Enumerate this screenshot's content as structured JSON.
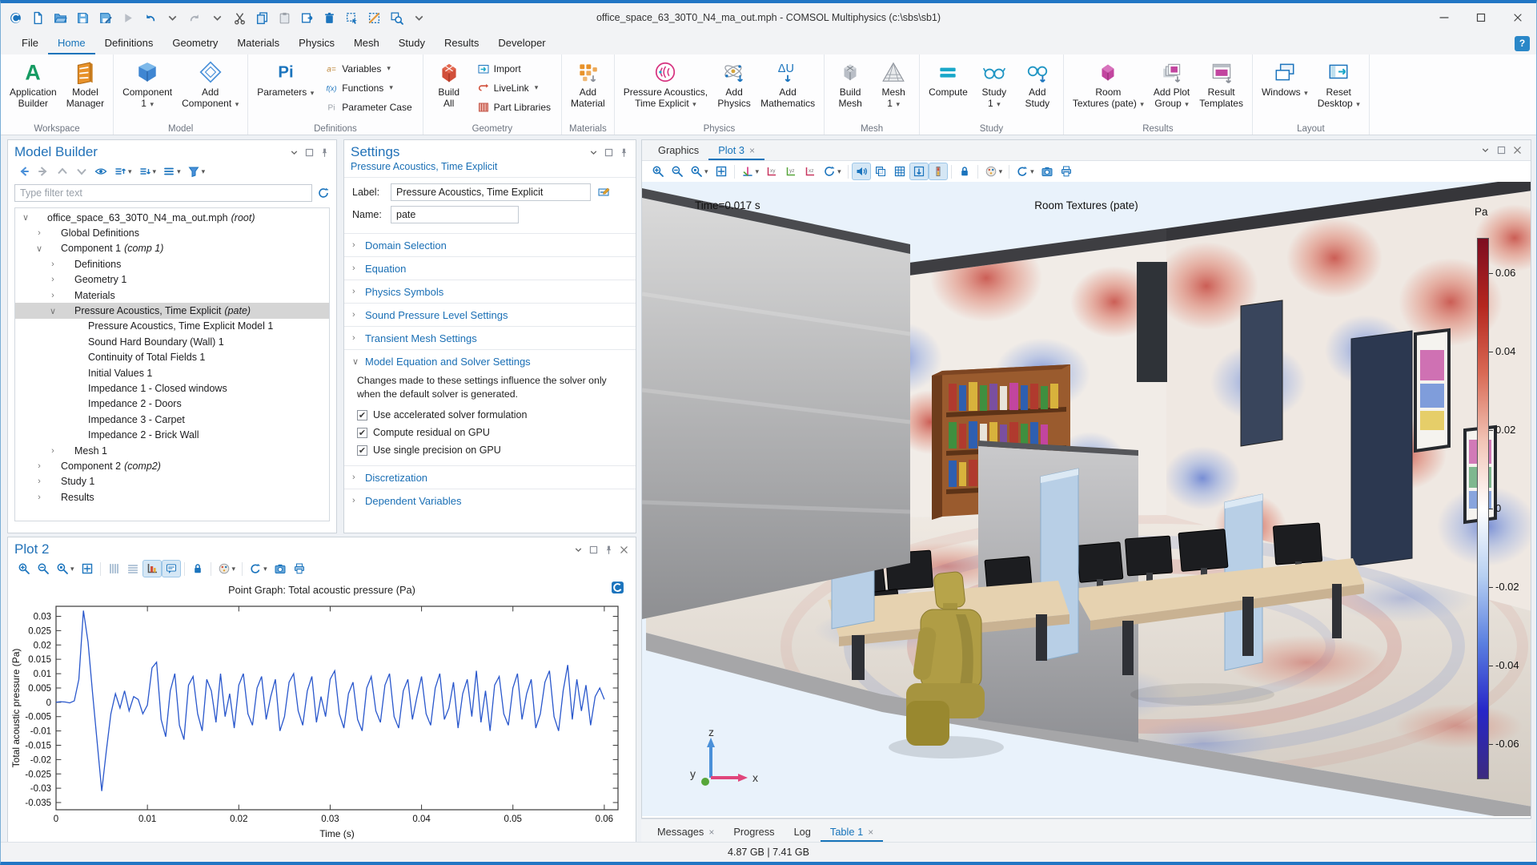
{
  "window": {
    "title": "office_space_63_30T0_N4_ma_out.mph - COMSOL Multiphysics (c:\\sbs\\sb1)"
  },
  "qat": [
    "comsol-logo",
    "new-file",
    "open-file",
    "save",
    "save-as",
    "run",
    "undo",
    "chevdn",
    "redo",
    "chevdn",
    "cut",
    "copy",
    "paste",
    "duplicate",
    "delete",
    "select-box",
    "deselect",
    "zoom-select",
    "chevdn"
  ],
  "menubar": {
    "items": [
      "File",
      "Home",
      "Definitions",
      "Geometry",
      "Materials",
      "Physics",
      "Mesh",
      "Study",
      "Results",
      "Developer"
    ],
    "active": "Home",
    "help": "?"
  },
  "ribbon": {
    "groups": [
      {
        "label": "Workspace",
        "buttons": [
          {
            "type": "large",
            "label": "Application\nBuilder",
            "icon": "app-builder"
          },
          {
            "type": "large",
            "label": "Model\nManager",
            "icon": "model-manager"
          }
        ]
      },
      {
        "label": "Model",
        "buttons": [
          {
            "type": "large",
            "label": "Component\n1",
            "icon": "component",
            "dd": true
          },
          {
            "type": "large",
            "label": "Add\nComponent",
            "icon": "add-component",
            "dd": true
          }
        ]
      },
      {
        "label": "Definitions",
        "buttons": [
          {
            "type": "large",
            "label": "Parameters",
            "icon": "parameters",
            "dd": true
          },
          {
            "type": "stack",
            "items": [
              {
                "label": "Variables",
                "icon": "variables",
                "dd": true
              },
              {
                "label": "Functions",
                "icon": "functions",
                "dd": true
              },
              {
                "label": "Parameter Case",
                "icon": "parameter-case"
              }
            ]
          }
        ]
      },
      {
        "label": "Geometry",
        "buttons": [
          {
            "type": "large",
            "label": "Build\nAll",
            "icon": "build-all"
          },
          {
            "type": "stack",
            "items": [
              {
                "label": "Import",
                "icon": "import"
              },
              {
                "label": "LiveLink",
                "icon": "livelink",
                "dd": true
              },
              {
                "label": "Part Libraries",
                "icon": "part-libraries"
              }
            ]
          }
        ]
      },
      {
        "label": "Materials",
        "buttons": [
          {
            "type": "large",
            "label": "Add\nMaterial",
            "icon": "add-material"
          }
        ]
      },
      {
        "label": "Physics",
        "buttons": [
          {
            "type": "large",
            "label": "Pressure Acoustics,\nTime Explicit",
            "icon": "pate",
            "dd": true
          },
          {
            "type": "large",
            "label": "Add\nPhysics",
            "icon": "add-physics"
          },
          {
            "type": "large",
            "label": "Add\nMathematics",
            "icon": "add-mathematics"
          }
        ]
      },
      {
        "label": "Mesh",
        "buttons": [
          {
            "type": "large",
            "label": "Build\nMesh",
            "icon": "build-mesh"
          },
          {
            "type": "large",
            "label": "Mesh\n1",
            "icon": "mesh",
            "dd": true
          }
        ]
      },
      {
        "label": "Study",
        "buttons": [
          {
            "type": "large",
            "label": "Compute",
            "icon": "compute"
          },
          {
            "type": "large",
            "label": "Study\n1",
            "icon": "study",
            "dd": true
          },
          {
            "type": "large",
            "label": "Add\nStudy",
            "icon": "add-study"
          }
        ]
      },
      {
        "label": "Results",
        "buttons": [
          {
            "type": "large",
            "label": "Room\nTextures (pate)",
            "icon": "room-textures",
            "dd": true
          },
          {
            "type": "large",
            "label": "Add Plot\nGroup",
            "icon": "add-plot-group",
            "dd": true
          },
          {
            "type": "large",
            "label": "Result\nTemplates",
            "icon": "result-templates"
          }
        ]
      },
      {
        "label": "Layout",
        "buttons": [
          {
            "type": "large",
            "label": "Windows",
            "icon": "windows",
            "dd": true
          },
          {
            "type": "large",
            "label": "Reset\nDesktop",
            "icon": "reset-desktop",
            "dd": true
          }
        ]
      }
    ]
  },
  "model_builder": {
    "title": "Model Builder",
    "toolbar": [
      {
        "icon": "nav-back"
      },
      {
        "icon": "nav-forward"
      },
      {
        "icon": "nav-up"
      },
      {
        "icon": "nav-down"
      },
      {
        "icon": "eye"
      },
      {
        "icon": "collapse",
        "dd": true
      },
      {
        "icon": "expand",
        "dd": true
      },
      {
        "icon": "listview",
        "dd": true
      },
      {
        "icon": "filter",
        "dd": true
      }
    ],
    "filter_placeholder": "Type filter text",
    "tree": [
      {
        "icon": "root",
        "label": "office_space_63_30T0_N4_ma_out.mph",
        "suffix": "(root)",
        "depth": 0,
        "expander": "open"
      },
      {
        "icon": "globe",
        "label": "Global Definitions",
        "suffix": "",
        "depth": 1,
        "expander": "closed"
      },
      {
        "icon": "component",
        "label": "Component 1",
        "suffix": "(comp 1)",
        "depth": 1,
        "expander": "open"
      },
      {
        "icon": "definitions",
        "label": "Definitions",
        "suffix": "",
        "depth": 2,
        "expander": "closed"
      },
      {
        "icon": "geometry",
        "label": "Geometry 1",
        "suffix": "",
        "depth": 2,
        "expander": "closed"
      },
      {
        "icon": "materials",
        "label": "Materials",
        "suffix": "",
        "depth": 2,
        "expander": "closed"
      },
      {
        "icon": "pate",
        "label": "Pressure Acoustics, Time Explicit",
        "suffix": "(pate)",
        "depth": 2,
        "expander": "open",
        "selected": true
      },
      {
        "icon": "dnode",
        "label": "Pressure Acoustics, Time Explicit Model 1",
        "suffix": "",
        "depth": 3
      },
      {
        "icon": "dnode",
        "label": "Sound Hard Boundary (Wall) 1",
        "suffix": "",
        "depth": 3
      },
      {
        "icon": "dnode",
        "label": "Continuity of Total Fields 1",
        "suffix": "",
        "depth": 3
      },
      {
        "icon": "dnode",
        "label": "Initial Values 1",
        "suffix": "",
        "depth": 3
      },
      {
        "icon": "bnode",
        "label": "Impedance 1 - Closed windows",
        "suffix": "",
        "depth": 3
      },
      {
        "icon": "bnode",
        "label": "Impedance 2 - Doors",
        "suffix": "",
        "depth": 3
      },
      {
        "icon": "bnode",
        "label": "Impedance 3 - Carpet",
        "suffix": "",
        "depth": 3
      },
      {
        "icon": "bnode",
        "label": "Impedance 2 - Brick Wall",
        "suffix": "",
        "depth": 3
      },
      {
        "icon": "mesh",
        "label": "Mesh 1",
        "suffix": "",
        "depth": 2,
        "expander": "closed"
      },
      {
        "icon": "component",
        "label": "Component 2",
        "suffix": "(comp2)",
        "depth": 1,
        "expander": "closed"
      },
      {
        "icon": "study",
        "label": "Study 1",
        "suffix": "",
        "depth": 1,
        "expander": "closed"
      },
      {
        "icon": "results",
        "label": "Results",
        "suffix": "",
        "depth": 1,
        "expander": "closed"
      }
    ]
  },
  "settings": {
    "title": "Settings",
    "subtitle": "Pressure Acoustics, Time Explicit",
    "label_field": {
      "label": "Label:",
      "value": "Pressure Acoustics, Time Explicit"
    },
    "name_field": {
      "label": "Name:",
      "value": "pate"
    },
    "sections": [
      {
        "label": "Domain Selection",
        "expanded": false
      },
      {
        "label": "Equation",
        "expanded": false
      },
      {
        "label": "Physics Symbols",
        "expanded": false
      },
      {
        "label": "Sound Pressure Level Settings",
        "expanded": false
      },
      {
        "label": "Transient Mesh Settings",
        "expanded": false
      },
      {
        "label": "Model Equation and Solver Settings",
        "expanded": true,
        "note": "Changes made to these settings influence the solver only when the default solver is generated.",
        "checkboxes": [
          {
            "label": "Use accelerated solver formulation",
            "checked": true
          },
          {
            "label": "Compute residual on GPU",
            "checked": true
          },
          {
            "label": "Use single precision on GPU",
            "checked": true
          }
        ]
      },
      {
        "label": "Discretization",
        "expanded": false
      },
      {
        "label": "Dependent Variables",
        "expanded": false
      }
    ]
  },
  "plot2": {
    "title": "Plot 2",
    "toolbar": [
      {
        "icon": "zoom-in"
      },
      {
        "icon": "zoom-out"
      },
      {
        "icon": "zoom-box",
        "dd": true
      },
      {
        "icon": "fit"
      },
      {
        "sep": true
      },
      {
        "icon": "xgrid"
      },
      {
        "icon": "ygrid"
      },
      {
        "icon": "axisbox",
        "active": true
      },
      {
        "icon": "annotation",
        "active": true
      },
      {
        "sep": true
      },
      {
        "icon": "lock"
      },
      {
        "sep": true
      },
      {
        "icon": "palette",
        "dd": true
      },
      {
        "sep": true
      },
      {
        "icon": "refresh",
        "dd": true
      },
      {
        "icon": "camera"
      },
      {
        "icon": "print"
      }
    ]
  },
  "chart_data": {
    "type": "line",
    "title": "Point Graph: Total acoustic pressure (Pa)",
    "xlabel": "Time (s)",
    "ylabel": "Total acoustic pressure (Pa)",
    "xlim": [
      0,
      0.0615
    ],
    "ylim": [
      -0.0375,
      0.0335
    ],
    "xticks": [
      0,
      0.01,
      0.02,
      0.03,
      0.04,
      0.05,
      0.06
    ],
    "yticks": [
      0.03,
      0.025,
      0.02,
      0.015,
      0.01,
      0.005,
      0,
      -0.005,
      -0.01,
      -0.015,
      -0.02,
      -0.025,
      -0.03,
      -0.035
    ],
    "grid": false,
    "line_color": "#2957cc",
    "series": [
      {
        "name": "Total acoustic pressure",
        "t0": 0,
        "dt": 0.0005,
        "values": [
          0,
          0.0002,
          0.0001,
          -0.0002,
          0.0005,
          0.008,
          0.032,
          0.021,
          0.003,
          -0.014,
          -0.031,
          -0.017,
          -0.004,
          0.003,
          -0.002,
          0.004,
          -0.003,
          0.002,
          0.001,
          -0.004,
          -0.001,
          0.012,
          0.014,
          -0.006,
          -0.012,
          0.004,
          0.01,
          -0.008,
          -0.013,
          0.006,
          0.009,
          -0.004,
          -0.01,
          0.008,
          0.004,
          -0.007,
          0.01,
          -0.005,
          0.003,
          -0.009,
          0.006,
          0.01,
          -0.004,
          -0.008,
          0.005,
          0.009,
          -0.006,
          0.002,
          0.008,
          -0.01,
          -0.005,
          0.007,
          0.01,
          -0.003,
          -0.008,
          0.004,
          0.009,
          -0.007,
          0.002,
          -0.005,
          0.008,
          0.011,
          -0.004,
          -0.009,
          0.003,
          0.007,
          -0.006,
          -0.01,
          0.005,
          0.009,
          -0.003,
          -0.007,
          0.006,
          0.01,
          -0.005,
          -0.009,
          0.004,
          0.008,
          -0.006,
          0.002,
          0.009,
          -0.004,
          -0.008,
          0.005,
          0.01,
          -0.006,
          -0.002,
          0.007,
          -0.009,
          0.003,
          0.008,
          -0.005,
          0.011,
          -0.007,
          0.004,
          -0.01,
          0.006,
          0.009,
          -0.004,
          -0.008,
          0.005,
          0.01,
          -0.006,
          0.003,
          0.008,
          -0.009,
          -0.004,
          0.007,
          0.011,
          -0.005,
          -0.01,
          0.004,
          0.013,
          -0.006,
          0.008,
          -0.003,
          0.006,
          -0.008,
          0.002,
          0.005,
          0.001
        ]
      }
    ]
  },
  "graphics": {
    "tabs": [
      {
        "label": "Graphics",
        "closable": false
      },
      {
        "label": "Plot 3",
        "closable": true
      }
    ],
    "active": "Plot 3",
    "toolbar": [
      {
        "icon": "zoom-in"
      },
      {
        "icon": "zoom-out"
      },
      {
        "icon": "zoom-box",
        "dd": true
      },
      {
        "icon": "fit"
      },
      {
        "sep": true
      },
      {
        "icon": "orient",
        "dd": true
      },
      {
        "icon": "view-xy"
      },
      {
        "icon": "view-yz"
      },
      {
        "icon": "view-xz"
      },
      {
        "icon": "rotate",
        "dd": true
      },
      {
        "sep": true
      },
      {
        "icon": "speaker",
        "active": true
      },
      {
        "icon": "transparency"
      },
      {
        "icon": "grid"
      },
      {
        "icon": "scene-arrows",
        "active": true
      },
      {
        "icon": "colorbar",
        "active": true
      },
      {
        "sep": true
      },
      {
        "icon": "lock"
      },
      {
        "sep": true
      },
      {
        "icon": "palette",
        "dd": true
      },
      {
        "sep": true
      },
      {
        "icon": "refresh",
        "dd": true
      },
      {
        "icon": "camera"
      },
      {
        "icon": "print"
      }
    ],
    "time_label": "Time=0.017 s",
    "plot_title": "Room Textures (pate)",
    "colorbar": {
      "unit": "Pa",
      "ticks": [
        0.06,
        0.04,
        0.02,
        0,
        -0.02,
        -0.04,
        -0.06
      ],
      "vmax": 0.069,
      "vmin": -0.069,
      "colors": [
        "#7d0d20",
        "#b5271f",
        "#d96a55",
        "#f2c4b6",
        "#ffffff",
        "#b7d0f2",
        "#5a7fe0",
        "#2726c8",
        "#3c2b7e"
      ]
    },
    "triad": {
      "up": "z",
      "right": "x",
      "front": "y"
    }
  },
  "bottom_tabs": {
    "tabs": [
      {
        "label": "Messages",
        "closable": true
      },
      {
        "label": "Progress",
        "closable": false
      },
      {
        "label": "Log",
        "closable": false
      },
      {
        "label": "Table 1",
        "closable": true
      }
    ],
    "active": "Table 1"
  },
  "statusbar": {
    "memory": "4.87 GB | 7.41 GB"
  }
}
